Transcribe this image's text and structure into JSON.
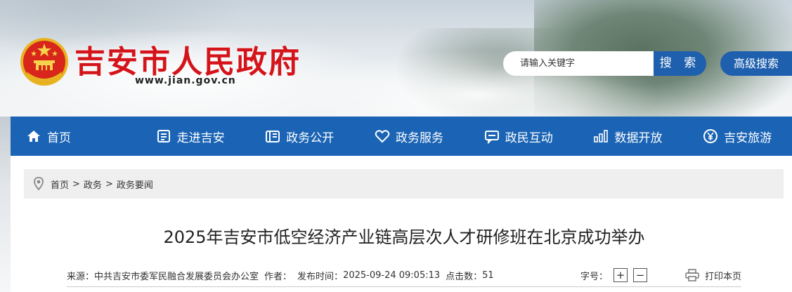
{
  "header": {
    "site_title": "吉安市人民政府",
    "site_url": "www.jian.gov.cn",
    "search_placeholder": "请输入关键字",
    "search_button": "搜 索",
    "advanced_search_button": "高级搜索"
  },
  "nav": {
    "items": [
      {
        "label": "首页",
        "icon": "home-icon"
      },
      {
        "label": "走进吉安",
        "icon": "book-icon"
      },
      {
        "label": "政务公开",
        "icon": "document-icon"
      },
      {
        "label": "政务服务",
        "icon": "heart-icon"
      },
      {
        "label": "政民互动",
        "icon": "chat-icon"
      },
      {
        "label": "数据开放",
        "icon": "bar-chart-icon"
      },
      {
        "label": "吉安旅游",
        "icon": "yen-icon"
      }
    ]
  },
  "breadcrumb": {
    "items": [
      "首页",
      "政务",
      "政务要闻"
    ],
    "separator": ">"
  },
  "article": {
    "title": "2025年吉安市低空经济产业链高层次人才研修班在北京成功举办",
    "source_label": "来源：",
    "source": "中共吉安市委军民融合发展委员会办公室",
    "author_label": "作者：",
    "publish_label": "发布时间：",
    "publish_time": "2025-09-24 09:05:13",
    "clicks_label": "点击数：",
    "clicks": "51",
    "font_size_label": "字号：",
    "font_plus": "+",
    "font_minus": "−",
    "print_label": "打印本页"
  },
  "colors": {
    "brand_red": "#d4141a",
    "nav_blue": "#1b64b5",
    "button_blue": "#1e5fae"
  }
}
